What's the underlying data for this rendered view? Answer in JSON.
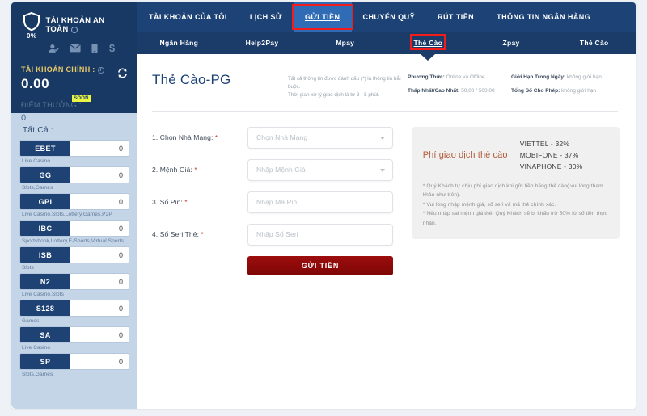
{
  "sidebar": {
    "secure_account": {
      "title": "TÀI KHOẢN AN TOÀN",
      "percent": "0%",
      "shield_icon": "shield-icon",
      "icons": [
        "person-check-icon",
        "envelope-icon",
        "phone-icon",
        "dollar-icon"
      ]
    },
    "main_account_label": "TÀI KHOẢN CHÍNH :",
    "balance": "0.00",
    "refresh_icon": "refresh-icon",
    "reward_label": "ĐIỂM THƯỞNG :",
    "reward_badge": "SOON",
    "reward_value": "0",
    "all_label": "Tất Cả :",
    "providers": [
      {
        "name": "EBET",
        "value": "0",
        "sub": "Live Casino"
      },
      {
        "name": "GG",
        "value": "0",
        "sub": "Slots,Games"
      },
      {
        "name": "GPI",
        "value": "0",
        "sub": "Live Casino,Slots,Lottery,Games,P2P"
      },
      {
        "name": "IBC",
        "value": "0",
        "sub": "Sportsbook,Lottery,E-Sports,Virtual Sports"
      },
      {
        "name": "ISB",
        "value": "0",
        "sub": "Slots"
      },
      {
        "name": "N2",
        "value": "0",
        "sub": "Live Casino,Slots"
      },
      {
        "name": "S128",
        "value": "0",
        "sub": "Games"
      },
      {
        "name": "SA",
        "value": "0",
        "sub": "Live Casino"
      },
      {
        "name": "SP",
        "value": "0",
        "sub": "Slots,Games"
      }
    ]
  },
  "nav": {
    "top": [
      {
        "label": "TÀI KHOẢN CỦA TÔI",
        "active": false
      },
      {
        "label": "LỊCH SỬ",
        "active": false
      },
      {
        "label": "GỬI TIỀN",
        "active": true
      },
      {
        "label": "CHUYỂN QUỸ",
        "active": false
      },
      {
        "label": "RÚT TIỀN",
        "active": false
      },
      {
        "label": "THÔNG TIN NGÂN HÀNG",
        "active": false
      }
    ],
    "sub": [
      {
        "label": "Ngân Hàng",
        "active": false
      },
      {
        "label": "Help2Pay",
        "active": false
      },
      {
        "label": "Mpay",
        "active": false
      },
      {
        "label": "Thẻ Cào",
        "active": true
      },
      {
        "label": "Zpay",
        "active": false
      },
      {
        "label": "Thẻ Cào",
        "active": false
      }
    ]
  },
  "header": {
    "title": "Thẻ Cào-PG",
    "note_line1": "Tất cả thông tin được đánh dấu (*) là thông tin bắt buộc.",
    "note_line2": "Thời gian xử lý giao dịch là từ 3 - 5 phút.",
    "meta": [
      {
        "key": "Phương Thức:",
        "value": "Online và Offline"
      },
      {
        "key": "Thấp Nhất/Cao Nhất:",
        "value": "50.00 / 500.00"
      },
      {
        "key": "Giới Hạn Trong Ngày:",
        "value": "không giới hạn"
      },
      {
        "key": "Tổng Số Cho Phép:",
        "value": "không giới hạn"
      }
    ]
  },
  "form": {
    "fields": [
      {
        "label": "1. Chọn Nhà Mạng:",
        "required": "*",
        "placeholder": "Chọn Nhà Mạng",
        "type": "select"
      },
      {
        "label": "2. Mệnh Giá:",
        "required": "*",
        "placeholder": "Nhập Mệnh Giá",
        "type": "select"
      },
      {
        "label": "3. Số Pin:",
        "required": "*",
        "placeholder": "Nhập Mã Pin",
        "type": "text"
      },
      {
        "label": "4. Số Seri Thẻ:",
        "required": "*",
        "placeholder": "Nhập Số Seri",
        "type": "text"
      }
    ],
    "submit_label": "GỬI TIỀN"
  },
  "fee_panel": {
    "title": "Phí giao dịch thẻ cào",
    "rates": [
      "VIETTEL - 32%",
      "MOBIFONE - 37%",
      "VINAPHONE - 30%"
    ],
    "notes": [
      "* Quý Khách tự chịu phí giao dịch khi gửi tiền bằng thẻ cào( vui lòng tham khảo như trên).",
      "* Vui lòng nhập mệnh giá, số seri và mã thẻ chính xác.",
      "* Nếu nhập sai mệnh giá thẻ, Quý Khách sẽ bị khấu trừ 50% từ số tiền thực nhận."
    ]
  },
  "colors": {
    "navy": "#1d4275",
    "navy_dark": "#1b3c69",
    "accent_blue": "#2f6cb5",
    "sidebar_blue": "#c5d5e8",
    "submit_red": "#8e0909",
    "annotation_red": "#f41b1b",
    "gold": "#e8c96a",
    "fee_title": "#b25a3a"
  }
}
